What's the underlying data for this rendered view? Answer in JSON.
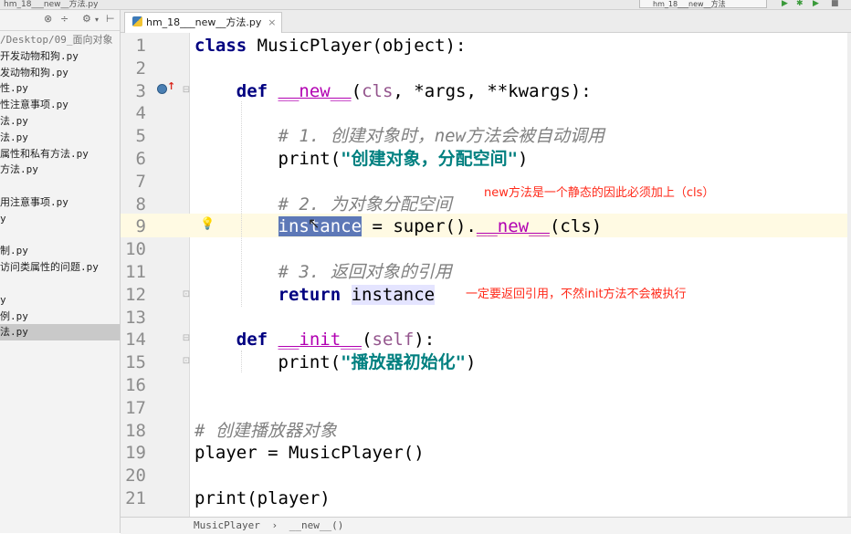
{
  "window": {
    "title": "hm_18___new__方法.py",
    "run_config": "hm_18___new__方法"
  },
  "sidebar": {
    "items": [
      {
        "label": "/Desktop/09_面向对象",
        "dim": true
      },
      {
        "label": "开发动物和狗.py"
      },
      {
        "label": "发动物和狗.py"
      },
      {
        "label": "性.py"
      },
      {
        "label": "性注意事项.py"
      },
      {
        "label": "法.py"
      },
      {
        "label": "法.py"
      },
      {
        "label": "属性和私有方法.py"
      },
      {
        "label": "方法.py"
      },
      {
        "label": ""
      },
      {
        "label": "用注意事项.py"
      },
      {
        "label": "y"
      },
      {
        "label": ""
      },
      {
        "label": "制.py"
      },
      {
        "label": "访问类属性的问题.py"
      },
      {
        "label": ""
      },
      {
        "label": "y"
      },
      {
        "label": "例.py"
      },
      {
        "label": "法.py",
        "selected": true
      }
    ]
  },
  "editor": {
    "tab_label": "hm_18___new__方法.py",
    "line_numbers": [
      "1",
      "2",
      "3",
      "4",
      "5",
      "6",
      "7",
      "8",
      "9",
      "10",
      "11",
      "12",
      "13",
      "14",
      "15",
      "16",
      "17",
      "18",
      "19",
      "20",
      "21"
    ],
    "code": {
      "l1_kw": "class",
      "l1_rest": " MusicPlayer(object):",
      "l3_def": "def",
      "l3_name": "__new__",
      "l3_open": "(",
      "l3_cls": "cls",
      "l3_rest": ", *args, **kwargs):",
      "l5_comment": "# 1. 创建对象时，new方法会被自动调用",
      "l6_print": "print(",
      "l6_str": "\"创建对象，分配空间\"",
      "l6_close": ")",
      "l8_comment": "# 2. 为对象分配空间",
      "l9_var": "instance",
      "l9_mid": " = super().",
      "l9_new": "__new__",
      "l9_tail": "(cls)",
      "l11_comment": "# 3. 返回对象的引用",
      "l12_return": "return",
      "l12_var": "instance",
      "l14_def": "def",
      "l14_name": "__init__",
      "l14_open": "(",
      "l14_self": "self",
      "l14_close": "):",
      "l15_print": "print(",
      "l15_str": "\"播放器初始化\"",
      "l15_close": ")",
      "l18_comment": "# 创建播放器对象",
      "l19": "player = MusicPlayer()",
      "l21": "print(player)"
    }
  },
  "annotations": {
    "note1": "new方法是一个静态的因此必须加上（cls）",
    "note2": "一定要返回引用，不然init方法不会被执行"
  },
  "breadcrumb": {
    "class_name": "MusicPlayer",
    "sep": "›",
    "method_name": "__new__()"
  },
  "colors": {
    "keyword": "#000080",
    "magic_method": "#b200b2",
    "self_param": "#94558d",
    "comment": "#808080",
    "string": "#008080",
    "selection": "#5d78b7",
    "annotation": "#ff2a1a"
  }
}
